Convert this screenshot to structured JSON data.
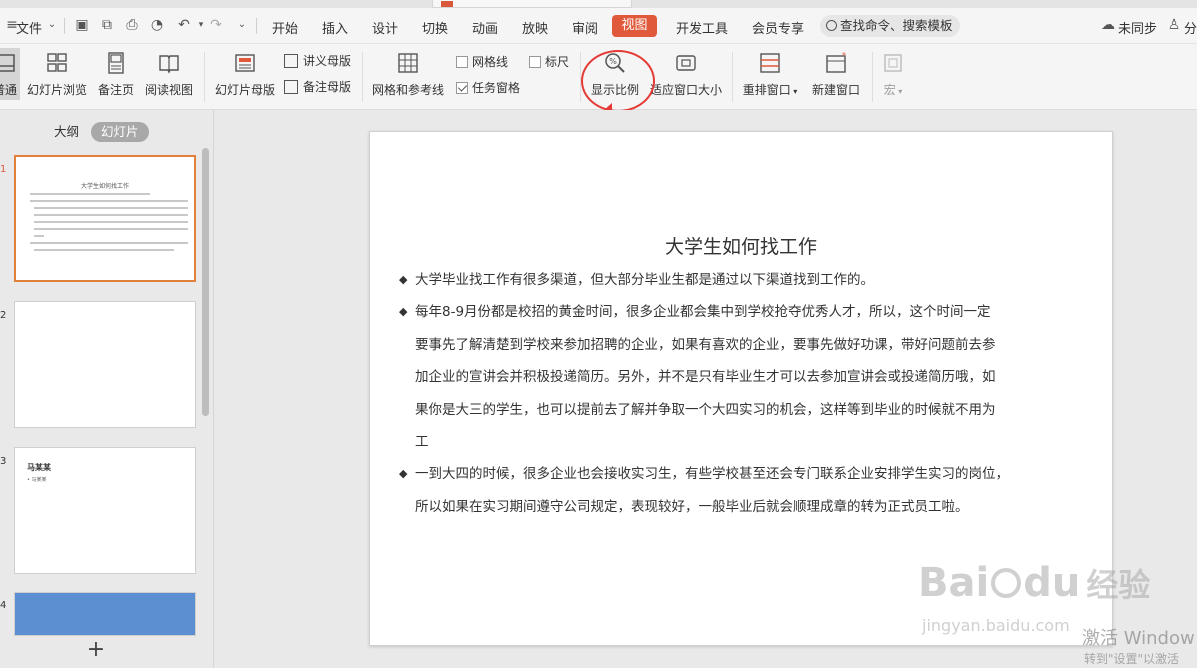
{
  "menubar": {
    "file": "文件",
    "tabs": [
      "开始",
      "插入",
      "设计",
      "切换",
      "动画",
      "放映",
      "审阅",
      "视图",
      "开发工具",
      "会员专享"
    ],
    "search": "查找命令、搜索模板",
    "sync": "未同步",
    "share": "分"
  },
  "ribbon": {
    "normal": "普通",
    "slide_browse": "幻灯片浏览",
    "notes_page": "备注页",
    "reading_view": "阅读视图",
    "slide_master": "幻灯片母版",
    "handout_master": "讲义母版",
    "notes_master": "备注母版",
    "grid_guides": "网格和参考线",
    "gridlines": "网格线",
    "ruler": "标尺",
    "task_pane": "任务窗格",
    "zoom": "显示比例",
    "fit_window": "适应窗口大小",
    "arrange_windows": "重排窗口",
    "new_window": "新建窗口",
    "macro": "宏"
  },
  "left_panel": {
    "outline_tab": "大纲",
    "slides_tab": "幻灯片",
    "slide_numbers": [
      "1",
      "2",
      "3",
      "4"
    ],
    "thumb1_title": "大学生如何找工作",
    "thumb3_title": "马某某",
    "thumb3_bullet": "马某某"
  },
  "slide": {
    "title": "大学生如何找工作",
    "paragraphs": [
      [
        "大学毕业找工作有很多渠道，但大部分毕业生都是通过以下渠道找到工作的。"
      ],
      [
        "每年8-9月份都是校招的黄金时间，很多企业都会集中到学校抢夺优秀人才，所以，这个时间一定",
        "要事先了解清楚到学校来参加招聘的企业，如果有喜欢的企业，要事先做好功课，带好问题前去参",
        "加企业的宣讲会并积极投递简历。另外，并不是只有毕业生才可以去参加宣讲会或投递简历哦，如",
        "果你是大三的学生，也可以提前去了解并争取一个大四实习的机会，这样等到毕业的时候就不用为",
        "工"
      ],
      [
        "一到大四的时候，很多企业也会接收实习生，有些学校甚至还会专门联系企业安排学生实习的岗位，",
        "所以如果在实习期间遵守公司规定，表现较好，一般毕业后就会顺理成章的转为正式员工啦。"
      ]
    ]
  },
  "watermark": {
    "baidu": "Bai",
    "baidu2": "du",
    "jingyan": "经验",
    "url": "jingyan.baidu.com",
    "activate": "激活 Window",
    "activate_sub": "转到\"设置\"以激活"
  },
  "colors": {
    "accent": "#e0593a",
    "annotation": "#e53935"
  }
}
